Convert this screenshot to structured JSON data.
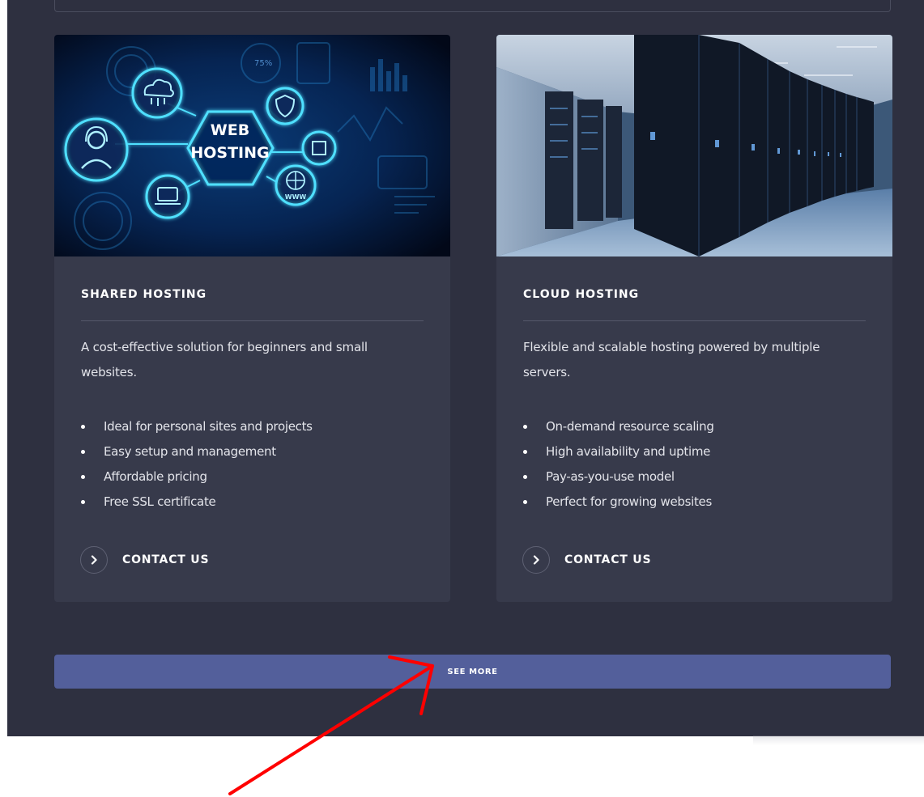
{
  "cards": [
    {
      "image_label": "web-hosting-illustration",
      "image_text": {
        "line1": "WEB",
        "line2": "HOSTING",
        "www": "WWW",
        "percent": "75%"
      },
      "title": "SHARED HOSTING",
      "description": "A cost-effective solution for beginners and small websites.",
      "features": [
        "Ideal for personal sites and projects",
        "Easy setup and management",
        "Affordable pricing",
        "Free SSL certificate"
      ],
      "cta_label": "CONTACT US",
      "cta_icon": "chevron-right-icon"
    },
    {
      "image_label": "server-room-photo",
      "title": "CLOUD HOSTING",
      "description": "Flexible and scalable hosting powered by multiple servers.",
      "features": [
        "On-demand resource scaling",
        "High availability and uptime",
        "Pay-as-you-use model",
        "Perfect for growing websites"
      ],
      "cta_label": "CONTACT US",
      "cta_icon": "chevron-right-icon"
    }
  ],
  "see_more_label": "SEE MORE",
  "colors": {
    "panel_bg": "#2e3040",
    "card_bg": "#373a4b",
    "button_bg": "#535f9b",
    "annotation_arrow": "#ff0000",
    "neon_cyan": "#38d8ff"
  },
  "annotation": {
    "type": "arrow",
    "target": "see-more-button"
  }
}
